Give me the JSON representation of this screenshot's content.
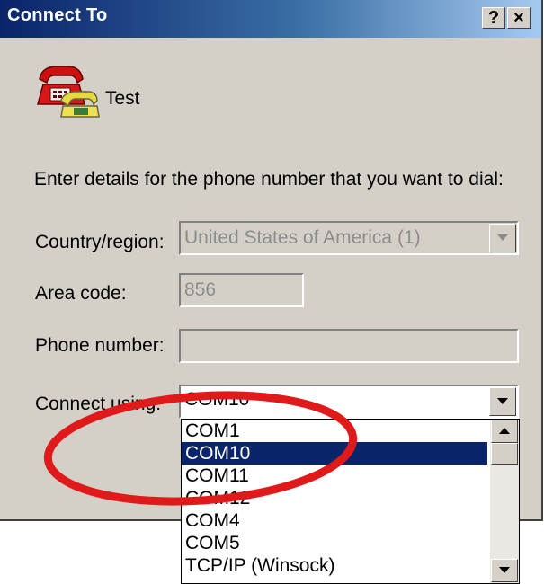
{
  "window": {
    "title": "Connect To",
    "help_button": "?",
    "close_button": "×"
  },
  "connection": {
    "name": "Test"
  },
  "instructions": "Enter details for the phone number that you want to dial:",
  "form": {
    "country": {
      "label": "Country/region:",
      "value": "United States of America (1)"
    },
    "area_code": {
      "label": "Area code:",
      "value": "856"
    },
    "phone_number": {
      "label": "Phone number:",
      "value": ""
    },
    "connect_using": {
      "label": "Connect using:",
      "value": "COM10",
      "options": [
        "COM1",
        "COM10",
        "COM11",
        "COM12",
        "COM4",
        "COM5",
        "TCP/IP (Winsock)"
      ],
      "selected_option": "COM10"
    }
  },
  "annotation": {
    "shape": "ellipse",
    "color": "#e0191a"
  }
}
